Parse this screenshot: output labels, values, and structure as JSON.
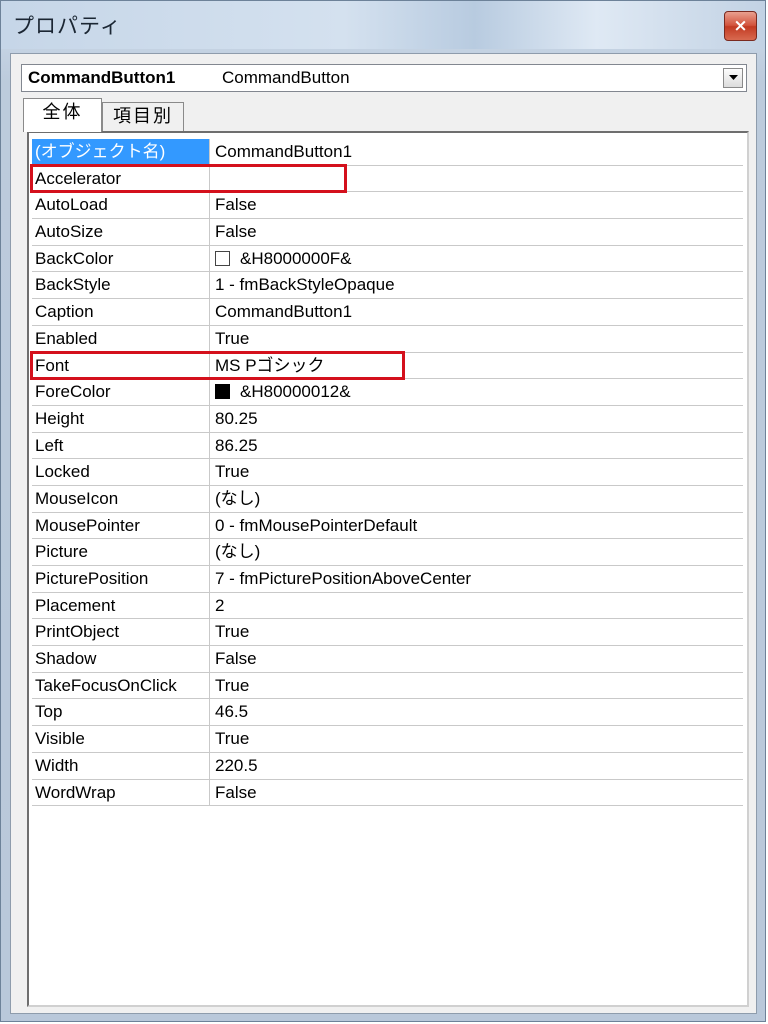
{
  "window": {
    "title": "プロパティ",
    "close_label": "×"
  },
  "object_selector": {
    "object_name": "CommandButton1",
    "object_type": "CommandButton"
  },
  "tabs": [
    {
      "label": "全体",
      "active": true
    },
    {
      "label": "項目別",
      "active": false
    }
  ],
  "properties": [
    {
      "name": "(オブジェクト名)",
      "value": "CommandButton1",
      "selected": true
    },
    {
      "name": "Accelerator",
      "value": "",
      "highlighted": true
    },
    {
      "name": "AutoLoad",
      "value": "False"
    },
    {
      "name": "AutoSize",
      "value": "False"
    },
    {
      "name": "BackColor",
      "value": "&H8000000F&",
      "swatch": "light"
    },
    {
      "name": "BackStyle",
      "value": "1 - fmBackStyleOpaque"
    },
    {
      "name": "Caption",
      "value": "CommandButton1",
      "highlighted": true
    },
    {
      "name": "Enabled",
      "value": "True"
    },
    {
      "name": "Font",
      "value": "MS Pゴシック"
    },
    {
      "name": "ForeColor",
      "value": "&H80000012&",
      "swatch": "dark"
    },
    {
      "name": "Height",
      "value": "80.25"
    },
    {
      "name": "Left",
      "value": "86.25"
    },
    {
      "name": "Locked",
      "value": "True"
    },
    {
      "name": "MouseIcon",
      "value": "(なし)"
    },
    {
      "name": "MousePointer",
      "value": "0 - fmMousePointerDefault"
    },
    {
      "name": "Picture",
      "value": "(なし)"
    },
    {
      "name": "PicturePosition",
      "value": "7 - fmPicturePositionAboveCenter"
    },
    {
      "name": "Placement",
      "value": "2"
    },
    {
      "name": "PrintObject",
      "value": "True"
    },
    {
      "name": "Shadow",
      "value": "False"
    },
    {
      "name": "TakeFocusOnClick",
      "value": "True"
    },
    {
      "name": "Top",
      "value": "46.5"
    },
    {
      "name": "Visible",
      "value": "True"
    },
    {
      "name": "Width",
      "value": "220.5"
    },
    {
      "name": "WordWrap",
      "value": "False"
    }
  ],
  "colors": {
    "selection": "#3399ff",
    "highlight_box": "#d4101c"
  }
}
